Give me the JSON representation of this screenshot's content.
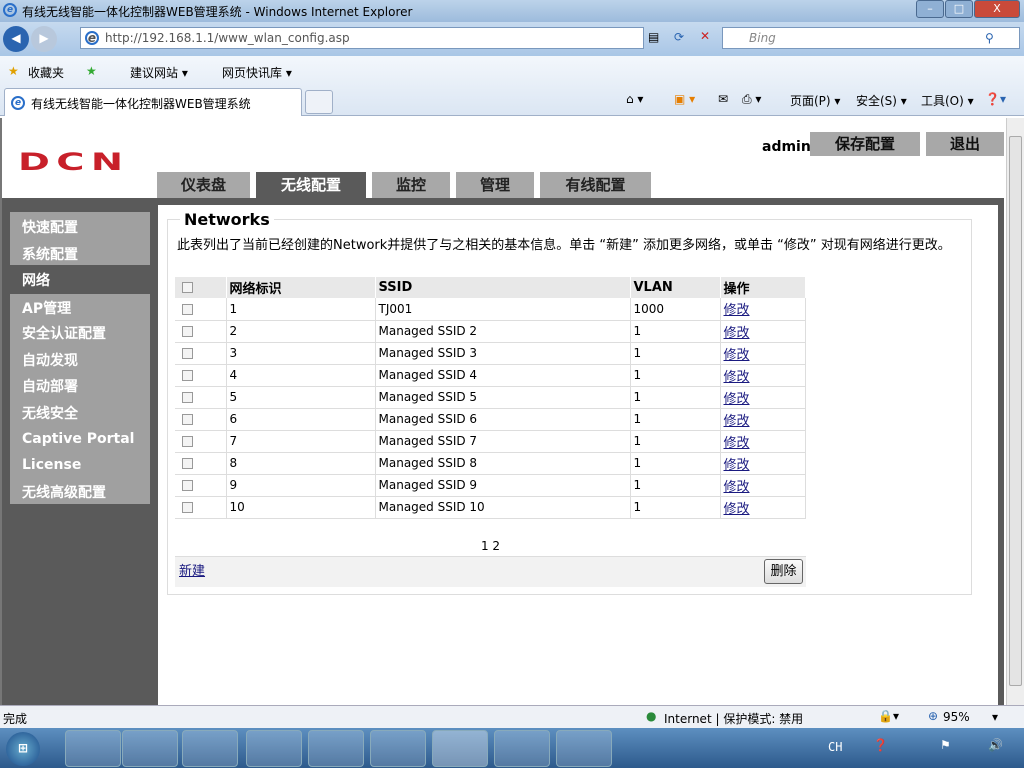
{
  "window": {
    "title": "有线无线智能一体化控制器WEB管理系统 - Windows Internet Explorer",
    "min": "–",
    "max": "□",
    "close": "X"
  },
  "nav": {
    "url": "http://192.168.1.1/www_wlan_config.asp",
    "search_placeholder": "Bing"
  },
  "favorites": {
    "favorites_label": "收藏夹",
    "links": [
      "建议网站 ▾",
      "网页快讯库 ▾"
    ]
  },
  "tab": {
    "title": "有线无线智能一体化控制器WEB管理系统"
  },
  "toolbar": {
    "page": "页面(P) ▾",
    "safety": "安全(S) ▾",
    "tools": "工具(O) ▾"
  },
  "header": {
    "logo": "DCN",
    "user": "admin",
    "save": "保存配置",
    "logout": "退出"
  },
  "tabs": [
    "仪表盘",
    "无线配置",
    "监控",
    "管理",
    "有线配置"
  ],
  "sidebar": [
    "快速配置",
    "系统配置",
    "网络",
    "AP管理",
    "安全认证配置",
    "自动发现",
    "自动部署",
    "无线安全",
    "Captive Portal",
    "License",
    "无线高级配置"
  ],
  "main": {
    "legend": "Networks",
    "description": "此表列出了当前已经创建的Network并提供了与之相关的基本信息。单击 “新建” 添加更多网络，或单击 “修改” 对现有网络进行更改。",
    "columns": [
      "网络标识",
      "SSID",
      "VLAN",
      "操作"
    ],
    "rows": [
      {
        "id": "1",
        "ssid": "TJ001",
        "vlan": "1000",
        "action": "修改"
      },
      {
        "id": "2",
        "ssid": "Managed SSID 2",
        "vlan": "1",
        "action": "修改"
      },
      {
        "id": "3",
        "ssid": "Managed SSID 3",
        "vlan": "1",
        "action": "修改"
      },
      {
        "id": "4",
        "ssid": "Managed SSID 4",
        "vlan": "1",
        "action": "修改"
      },
      {
        "id": "5",
        "ssid": "Managed SSID 5",
        "vlan": "1",
        "action": "修改"
      },
      {
        "id": "6",
        "ssid": "Managed SSID 6",
        "vlan": "1",
        "action": "修改"
      },
      {
        "id": "7",
        "ssid": "Managed SSID 7",
        "vlan": "1",
        "action": "修改"
      },
      {
        "id": "8",
        "ssid": "Managed SSID 8",
        "vlan": "1",
        "action": "修改"
      },
      {
        "id": "9",
        "ssid": "Managed SSID 9",
        "vlan": "1",
        "action": "修改"
      },
      {
        "id": "10",
        "ssid": "Managed SSID 10",
        "vlan": "1",
        "action": "修改"
      }
    ],
    "pages": [
      "1",
      "2"
    ],
    "new": "新建",
    "delete": "删除"
  },
  "status": {
    "text": "完成",
    "zone": "Internet | 保护模式: 禁用",
    "zoom": "95%"
  },
  "tray": {
    "lang": "CH"
  }
}
